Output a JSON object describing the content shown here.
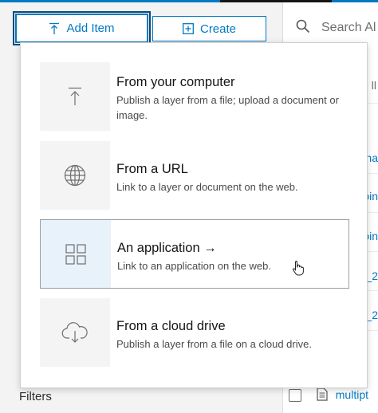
{
  "toolbar": {
    "add_item_label": "Add Item",
    "create_label": "Create"
  },
  "search": {
    "placeholder": "Search Al"
  },
  "dropdown": {
    "options": [
      {
        "title": "From your computer",
        "description": "Publish a layer from a file; upload a document or image.",
        "icon": "upload-icon"
      },
      {
        "title": "From a URL",
        "description": "Link to a layer or document on the web.",
        "icon": "globe-icon"
      },
      {
        "title": "An application →",
        "description": "Link to an application on the web.",
        "icon": "apps-grid-icon"
      },
      {
        "title": "From a cloud drive",
        "description": "Publish a layer from a file on a cloud drive.",
        "icon": "cloud-download-icon"
      }
    ]
  },
  "list": {
    "header_fragment": "ll",
    "link_fragments": [
      "na",
      "oin",
      "oin",
      "_2",
      "_2"
    ],
    "last_item": "multipt"
  },
  "sidebar": {
    "filters_label": "Filters"
  },
  "colors": {
    "accent": "#0079c1",
    "active_option_bg": "#e8f2fb"
  }
}
